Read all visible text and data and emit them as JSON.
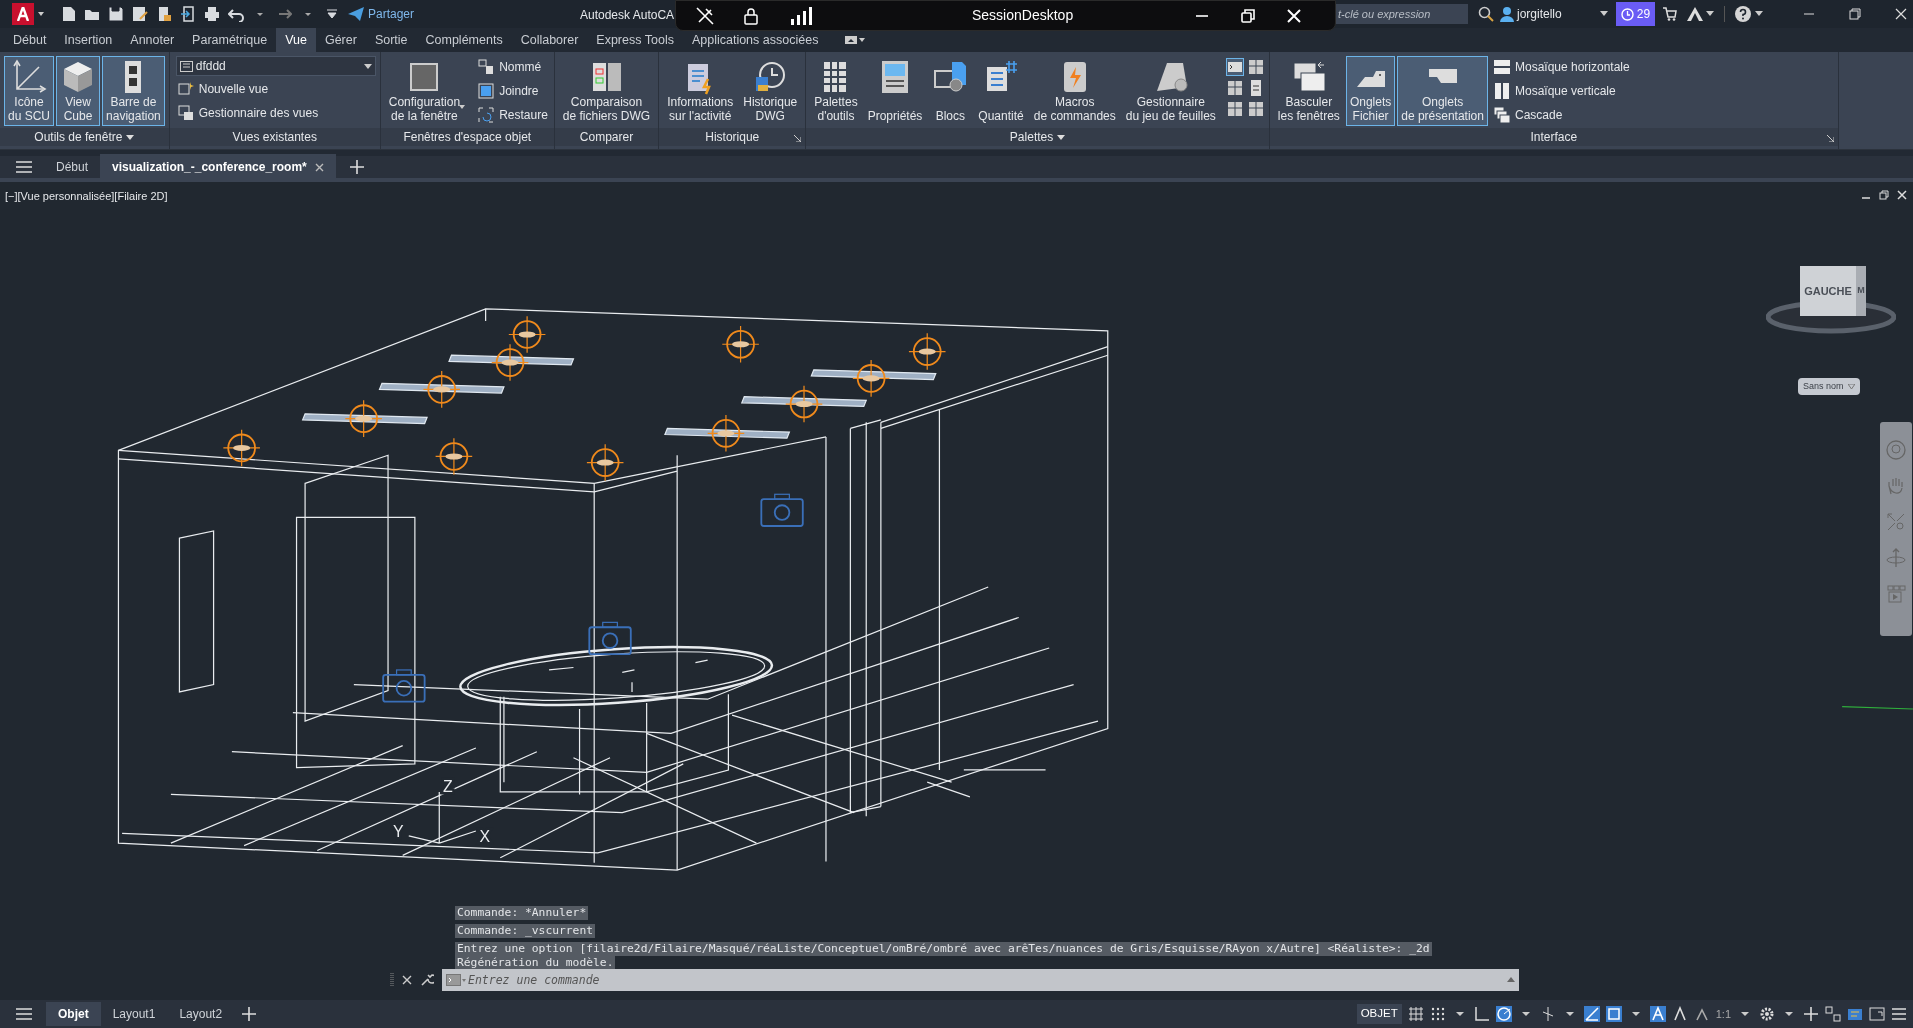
{
  "title_bar": {
    "share": "Partager",
    "app_title": "Autodesk AutoCA",
    "search": {
      "placeholder": "t-clé ou expression"
    },
    "user": "jorgitello",
    "badge": "29"
  },
  "session_window": {
    "title": "SessionDesktop"
  },
  "menu_tabs": [
    {
      "label": "Début",
      "selected": false
    },
    {
      "label": "Insertion",
      "selected": false
    },
    {
      "label": "Annoter",
      "selected": false
    },
    {
      "label": "Paramétrique",
      "selected": false
    },
    {
      "label": "Vue",
      "selected": true
    },
    {
      "label": "Gérer",
      "selected": false
    },
    {
      "label": "Sortie",
      "selected": false
    },
    {
      "label": "Compléments",
      "selected": false
    },
    {
      "label": "Collaborer",
      "selected": false
    },
    {
      "label": "Express Tools",
      "selected": false
    },
    {
      "label": "Applications associées",
      "selected": false
    }
  ],
  "ribbon": {
    "panels": [
      {
        "title": "Outils de fenêtre",
        "title_menu": true,
        "large_buttons": [
          {
            "label": "Icône\ndu SCU",
            "selected": true
          },
          {
            "label": "View\nCube",
            "selected": true
          },
          {
            "label": "Barre de\nnavigation",
            "selected": true
          }
        ]
      },
      {
        "title": "Vues existantes",
        "dropdown": {
          "value": "dfddd"
        },
        "small_buttons": [
          "Nouvelle vue",
          "Gestionnaire des vues"
        ]
      },
      {
        "title": "Fenêtres d'espace objet",
        "large_buttons": [
          {
            "label": "Configuration\nde la fenêtre",
            "selected": false
          }
        ],
        "small_buttons": [
          "Nommé",
          "Joindre",
          "Restaure"
        ]
      },
      {
        "title": "Comparer",
        "large_buttons": [
          {
            "label": "Comparaison\nde fichiers DWG",
            "selected": false
          }
        ]
      },
      {
        "title": "Historique",
        "launcher": true,
        "large_buttons": [
          {
            "label": "Informations\nsur l'activité",
            "selected": false
          },
          {
            "label": "Historique\nDWG",
            "selected": false
          }
        ]
      },
      {
        "title": "Palettes",
        "title_menu": true,
        "large_buttons": [
          {
            "label": "Palettes\nd'outils",
            "selected": false
          },
          {
            "label": "Propriétés",
            "selected": false
          },
          {
            "label": "Blocs",
            "selected": false
          },
          {
            "label": "Quantité",
            "selected": false
          },
          {
            "label": "Macros\nde commandes",
            "selected": false
          },
          {
            "label": "Gestionnaire\ndu jeu de feuilles",
            "selected": false
          }
        ]
      },
      {
        "title": "Interface",
        "launcher": true,
        "large_buttons": [
          {
            "label": "Basculer\nles fenêtres",
            "selected": false
          },
          {
            "label": "Onglets\nFichier",
            "selected": true
          },
          {
            "label": "Onglets\nde présentation",
            "selected": true
          }
        ],
        "small_buttons": [
          "Mosaïque horizontale",
          "Mosaïque verticale",
          "Cascade"
        ]
      }
    ]
  },
  "doc_tabs": [
    {
      "label": "Début",
      "selected": false
    },
    {
      "label": "visualization_-_conference_room*",
      "selected": true
    }
  ],
  "viewport": {
    "label": "[−][Vue personnalisée][Filaire 2D]",
    "viewcube": {
      "face": "GAUCHE",
      "side": "M",
      "view_menu": "Sans nom"
    },
    "ucs": {
      "z": "Z",
      "y": "Y",
      "x": "X"
    }
  },
  "command_line": {
    "history": [
      "Commande: *Annuler*",
      "Commande: _vscurrent",
      "Entrez une option [filaire2d/Filaire/Masqué/réaListe/Conceptuel/omBré/ombré avec arêTes/nuances de Gris/Esquisse/RAyon x/Autre] <Réaliste>: _2d",
      "Régénération du modèle."
    ],
    "placeholder": "Entrez une commande"
  },
  "layout_tabs": [
    {
      "label": "Objet",
      "selected": true
    },
    {
      "label": "Layout1",
      "selected": false
    },
    {
      "label": "Layout2",
      "selected": false
    }
  ],
  "status_bar": {
    "space": "OBJET",
    "scale": "1:1"
  }
}
